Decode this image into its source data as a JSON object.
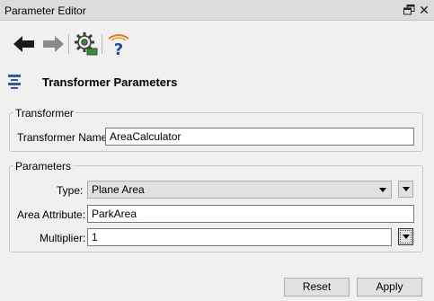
{
  "window": {
    "title": "Parameter Editor",
    "close_glyph": "✕"
  },
  "toolbar": {
    "back_icon": "arrow-left-icon",
    "forward_icon": "arrow-right-icon",
    "settings_icon": "gear-settings-icon",
    "help_icon": "help-icon"
  },
  "header": {
    "title": "Transformer Parameters",
    "icon": "transformer-icon"
  },
  "transformer_group": {
    "title": "Transformer",
    "name_label": "Transformer Name:",
    "name_value": "AreaCalculator"
  },
  "parameters_group": {
    "title": "Parameters",
    "type_label": "Type:",
    "type_value": "Plane Area",
    "area_attribute_label": "Area Attribute:",
    "area_attribute_value": "ParkArea",
    "multiplier_label": "Multiplier:",
    "multiplier_value": "1"
  },
  "footer": {
    "reset_label": "Reset",
    "apply_label": "Apply"
  },
  "colors": {
    "titlebar": "#dcdcdc",
    "background": "#f0f0f0",
    "arrow_active": "#1a1a1a",
    "arrow_disabled": "#8a8a8a",
    "gear_green": "#3c8a3c"
  }
}
